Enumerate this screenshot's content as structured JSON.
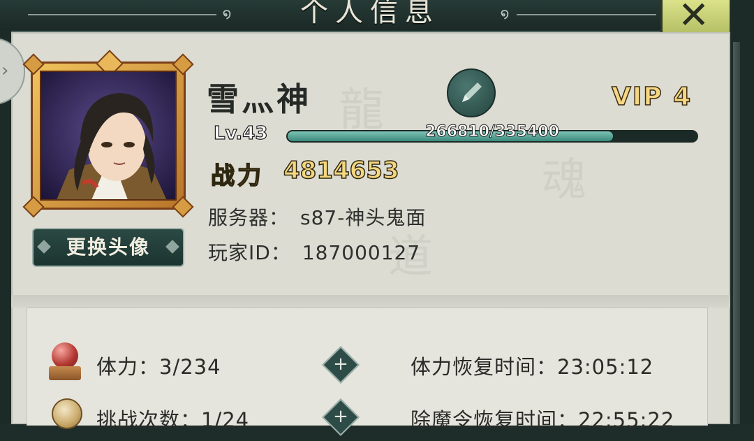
{
  "header": {
    "title": "个人信息"
  },
  "profile": {
    "name": "雪灬神",
    "vip": "VIP 4",
    "level": "Lv.43",
    "xp_text": "266810/335400",
    "xp_fraction": 0.7955,
    "power_label": "战力",
    "power_value": "4814653",
    "server_label": "服务器：",
    "server_value": "s87-神头鬼面",
    "player_id_label": "玩家ID：",
    "player_id_value": "187000127",
    "change_avatar_label": "更换头像"
  },
  "stats": [
    {
      "label": "体力：3/234",
      "recover": "体力恢复时间：23:05:12",
      "icon": "stamina-orb-icon"
    },
    {
      "label": "挑战次数：1/24",
      "recover": "除魔令恢复时间：22:55:22",
      "icon": "challenge-token-icon"
    }
  ],
  "colors": {
    "accent_gold": "#f4d77f",
    "panel_bg": "#dcdcd3",
    "dark_teal": "#24433e",
    "xp_fill": "#3a8a7c"
  }
}
